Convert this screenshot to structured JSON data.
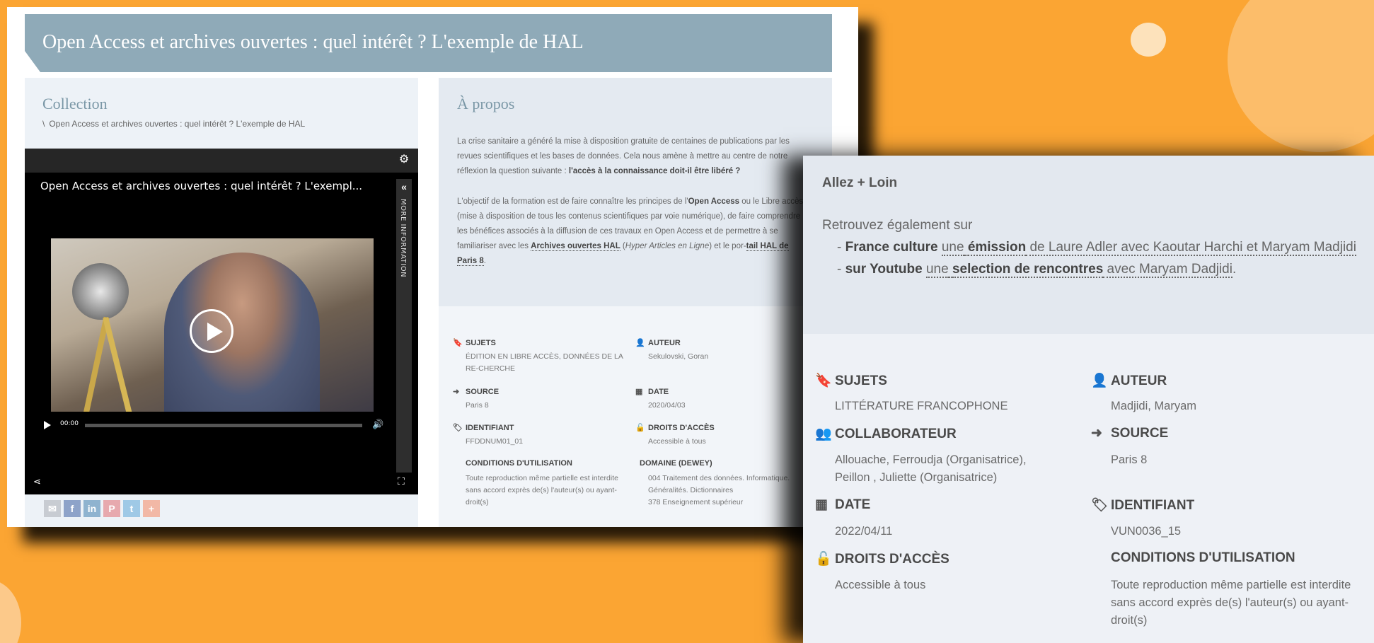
{
  "left_page": {
    "header_title": "Open Access et archives ouvertes : quel intérêt ? L'exemple de HAL",
    "collection": {
      "title": "Collection",
      "breadcrumb_sep": "\\",
      "breadcrumb_item": "Open Access et archives ouvertes : quel intérêt ? L'exemple de HAL"
    },
    "about": {
      "title": "À propos",
      "p1_a": "La crise sanitaire a généré la mise à disposition gratuite de centaines de publications par les revues scientifiques et les bases de données. Cela nous amène à mettre au centre de notre réflexion la question suivante : ",
      "p1_b": "l'accès à la connaissance doit-il être libéré ?",
      "p2_a": "L'objectif de la formation est de faire connaître les principes de l'",
      "p2_b": "Open Access",
      "p2_c": " ou le Libre accès (mise à disposition de tous les contenus scientifiques par voie numérique), de faire comprendre les bénéfices associés à la diffusion de ces travaux en Open Access et de permettre à se familiariser avec les ",
      "p2_d": "Archives ouvertes HAL",
      "p2_e": " (",
      "p2_f": "Hyper Articles en Ligne",
      "p2_g": ") et le por-",
      "p2_h": "tail HAL de Paris 8",
      "p2_i": "."
    },
    "player": {
      "title": "Open Access et archives ouvertes : quel intérêt ? L'exempl...",
      "more_info": "MORE INFORMATION",
      "time": "00:00"
    },
    "share_icons": [
      "mail-icon",
      "facebook-icon",
      "linkedin-icon",
      "pinterest-icon",
      "twitter-icon",
      "plus-icon"
    ],
    "meta": {
      "sujets_label": "SUJETS",
      "sujets_value": "ÉDITION EN LIBRE ACCÈS, DONNÉES DE LA RE-CHERCHE",
      "auteur_label": "AUTEUR",
      "auteur_value": "Sekulovski, Goran",
      "source_label": "SOURCE",
      "source_value": "Paris 8",
      "date_label": "DATE",
      "date_value": "2020/04/03",
      "identifiant_label": "IDENTIFIANT",
      "identifiant_value": "FFDDNUM01_01",
      "droits_label": "DROITS D'ACCÈS",
      "droits_value": "Accessible à tous",
      "conditions_label": "CONDITIONS D'UTILISATION",
      "conditions_value": "Toute reproduction même partielle est interdite sans accord exprès de(s) l'auteur(s) ou ayant-droit(s)",
      "dewey_label": "DOMAINE (DEWEY)",
      "dewey_value_1": "004 Traitement des données. Informatique. Généralités. Dictionnaires",
      "dewey_value_2": "378 Enseignement supérieur"
    }
  },
  "right_page": {
    "heading": "Allez + Loin",
    "intro": "Retrouvez également sur",
    "line1": {
      "dash": "- ",
      "a": "France culture",
      "b": " ",
      "c": "une",
      "d": " ",
      "e": "émission",
      "f": " de Laure Adler avec Kaoutar Harchi et Maryam Madjidi"
    },
    "line2": {
      "dash": "- ",
      "a": "sur Youtube",
      "b": " ",
      "c": "une",
      "d": " ",
      "e": "selection de rencontres",
      "f": " avec Maryam Dadjidi",
      "g": "."
    },
    "meta": {
      "sujets_label": "SUJETS",
      "sujets_value": "LITTÉRATURE FRANCOPHONE",
      "auteur_label": "AUTEUR",
      "auteur_value": "Madjidi, Maryam",
      "collab_label": "COLLABORATEUR",
      "collab_value": "Allouache, Ferroudja (Organisatrice), Peillon , Juliette (Organisatrice)",
      "source_label": "SOURCE",
      "source_value": "Paris 8",
      "date_label": "DATE",
      "date_value": "2022/04/11",
      "identifiant_label": "IDENTIFIANT",
      "identifiant_value": "VUN0036_15",
      "droits_label": "DROITS D'ACCÈS",
      "droits_value": "Accessible à tous",
      "conditions_label": "CONDITIONS D'UTILISATION",
      "conditions_value": "Toute reproduction même partielle est interdite sans accord exprès de(s) l'auteur(s) ou ayant-droit(s)"
    }
  },
  "colors": {
    "background": "#fba533",
    "header": "#8faab8",
    "accent_title": "#7a97a6"
  }
}
